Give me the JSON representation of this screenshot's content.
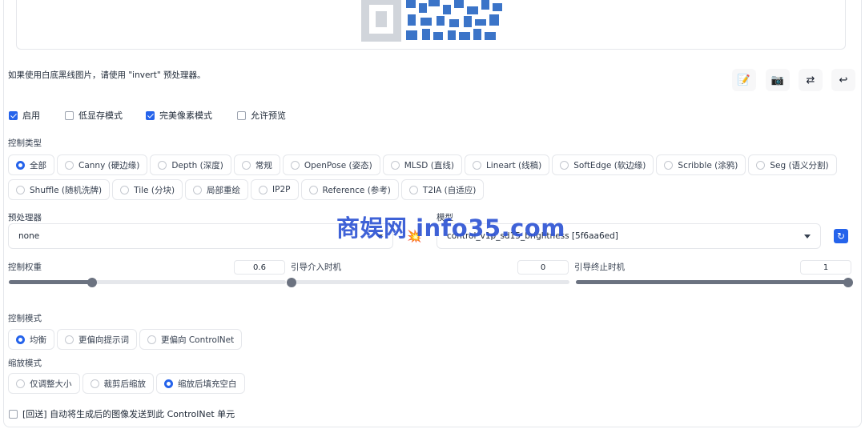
{
  "hint_text": "如果使用白底黑线图片，请使用 \"invert\" 预处理器。",
  "toolbar": {
    "icons": [
      "memo-icon",
      "camera-icon",
      "swap-icon",
      "send-arrow-icon"
    ],
    "glyphs": [
      "📝",
      "📷",
      "⇄",
      "↩"
    ]
  },
  "options": [
    {
      "label": "启用",
      "checked": true
    },
    {
      "label": "低显存模式",
      "checked": false
    },
    {
      "label": "完美像素模式",
      "checked": true
    },
    {
      "label": "允许预览",
      "checked": false
    }
  ],
  "control_type": {
    "label": "控制类型",
    "row1": [
      "全部",
      "Canny (硬边缘)",
      "Depth (深度)",
      "常规",
      "OpenPose (姿态)",
      "MLSD (直线)",
      "Lineart (线稿)",
      "SoftEdge (软边缘)",
      "Scribble (涂鸦)",
      "Seg (语义分割)"
    ],
    "row2": [
      "Shuffle (随机洗牌)",
      "Tile (分块)",
      "局部重绘",
      "IP2P",
      "Reference (参考)",
      "T2IA (自适应)"
    ],
    "selected": "全部"
  },
  "preprocessor": {
    "label": "预处理器",
    "value": "none"
  },
  "model": {
    "label": "模型",
    "value": "control_v1p_sd15_brightness [5f6aa6ed]"
  },
  "explode_icon": "💥",
  "refresh_icon": "↻",
  "sliders": [
    {
      "label": "控制权重",
      "value": "0.6",
      "fraction": 0.3
    },
    {
      "label": "引导介入时机",
      "value": "0",
      "fraction": 0.0
    },
    {
      "label": "引导终止时机",
      "value": "1",
      "fraction": 1.0
    }
  ],
  "control_mode": {
    "label": "控制模式",
    "options": [
      "均衡",
      "更偏向提示词",
      "更偏向 ControlNet"
    ],
    "selected": "均衡"
  },
  "resize_mode": {
    "label": "缩放模式",
    "options": [
      "仅调整大小",
      "裁剪后缩放",
      "缩放后填充空白"
    ],
    "selected": "缩放后填充空白"
  },
  "loopback": {
    "label": "[回送] 自动将生成后的图像发送到此 ControlNet 单元",
    "checked": false
  },
  "watermark": "商娱网 info35.com",
  "colors": {
    "accent": "#2563eb",
    "slider": "#6b7280",
    "watermark": "#2f55d4"
  }
}
